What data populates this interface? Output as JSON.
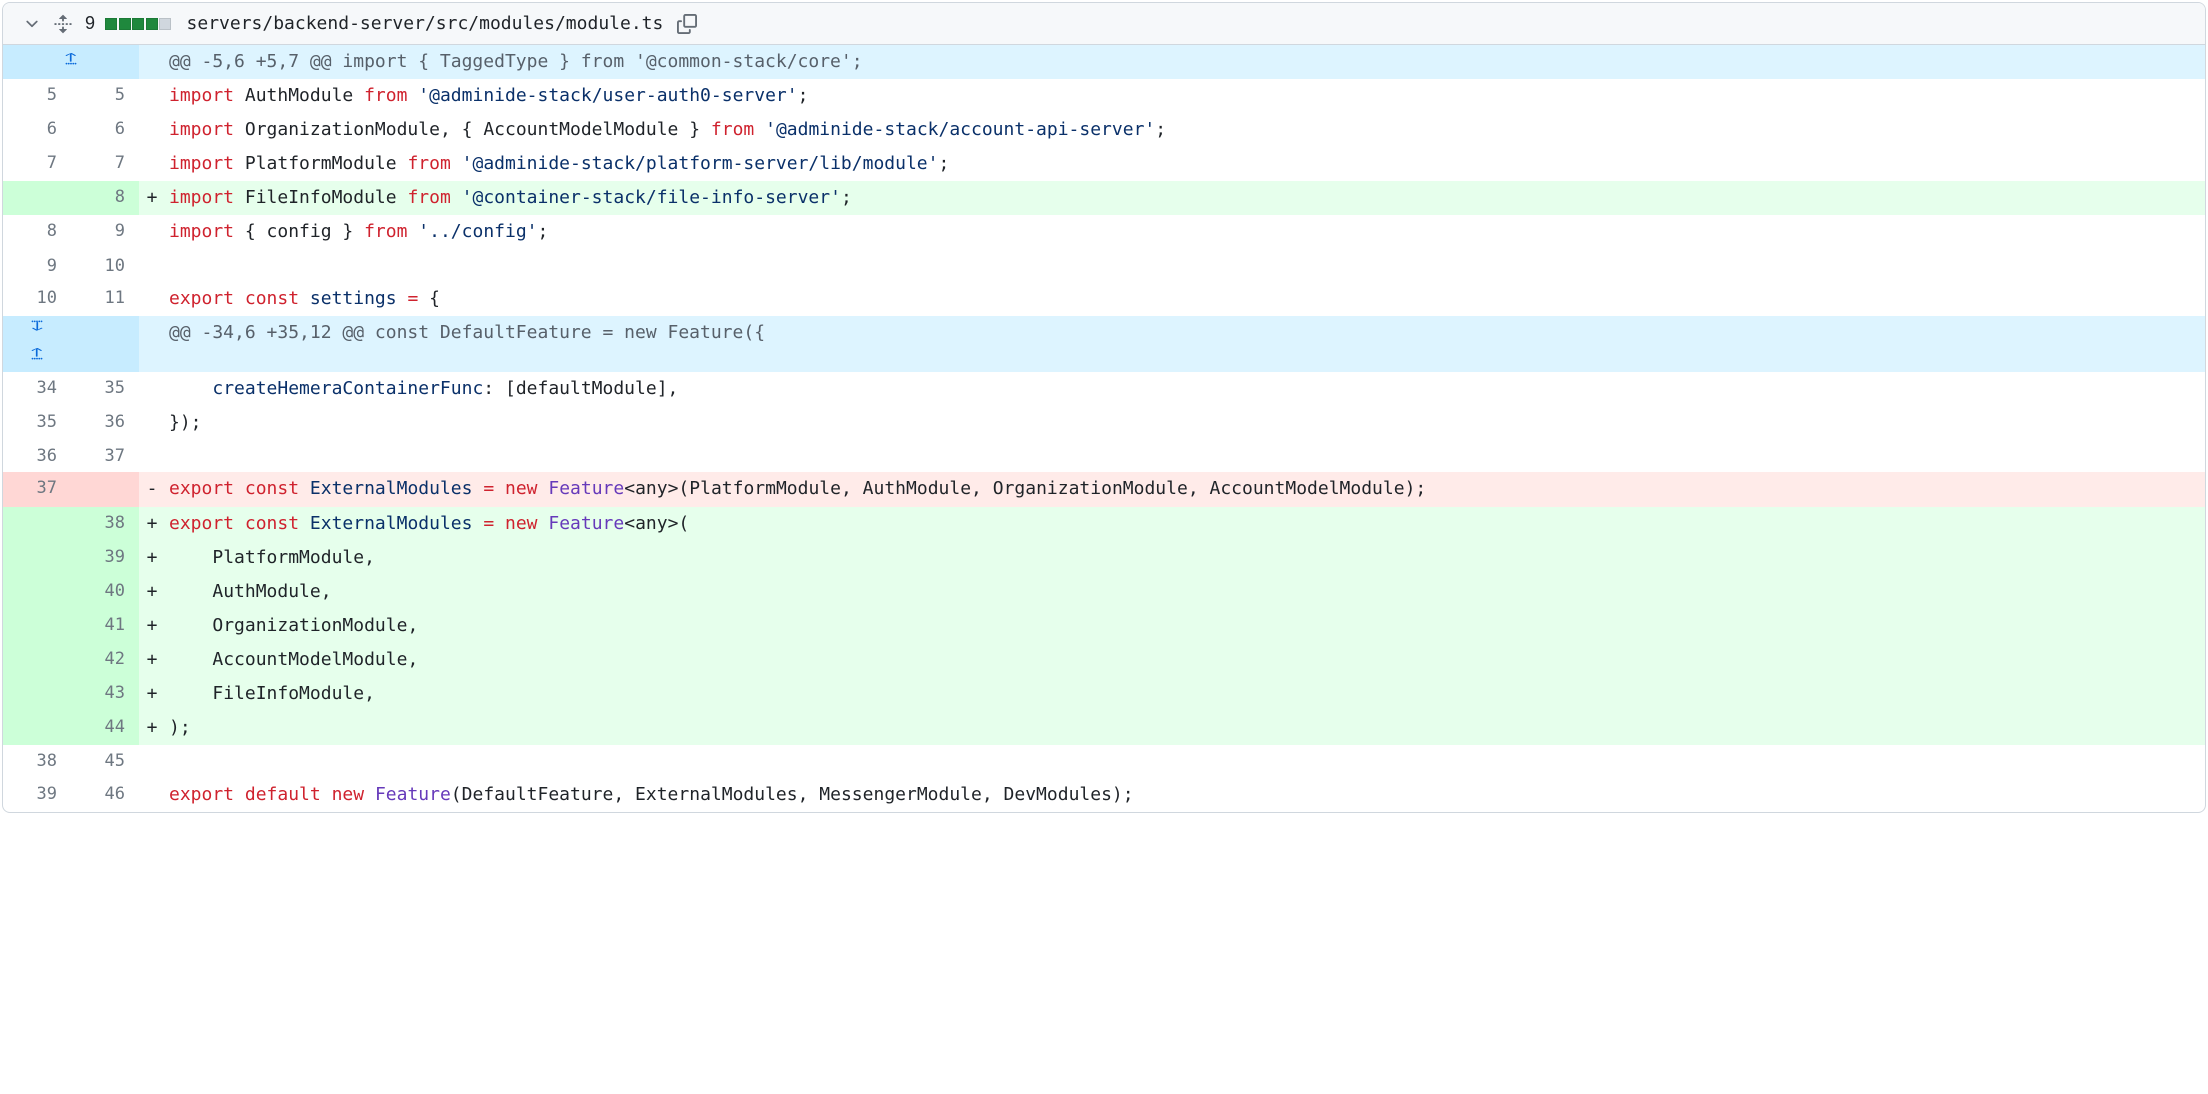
{
  "header": {
    "diff_count": "9",
    "file_path": "servers/backend-server/src/modules/module.ts"
  },
  "hunks": {
    "h1_text": "@@ -5,6 +5,7 @@ import { TaggedType } from '@common-stack/core';",
    "h2_text": "@@ -34,6 +35,12 @@ const DefaultFeature = new Feature({"
  },
  "rows": [
    {
      "old": "5",
      "new": "5",
      "marker": "",
      "type": "context",
      "code": "<span class=\"k\">import</span> <span class=\"v\">AuthModule</span> <span class=\"k\">from</span> <span class=\"s\">'@adminide-stack/user-auth0-server'</span>;"
    },
    {
      "old": "6",
      "new": "6",
      "marker": "",
      "type": "context",
      "code": "<span class=\"k\">import</span> <span class=\"v\">OrganizationModule</span>, { <span class=\"v\">AccountModelModule</span> } <span class=\"k\">from</span> <span class=\"s\">'@adminide-stack/account-api-server'</span>;"
    },
    {
      "old": "7",
      "new": "7",
      "marker": "",
      "type": "context",
      "code": "<span class=\"k\">import</span> <span class=\"v\">PlatformModule</span> <span class=\"k\">from</span> <span class=\"s\">'@adminide-stack/platform-server/lib/module'</span>;"
    },
    {
      "old": "",
      "new": "8",
      "marker": "+",
      "type": "addition",
      "code": "<span class=\"k\">import</span> <span class=\"v\">FileInfoModule</span> <span class=\"k\">from</span> <span class=\"s\">'@container-stack/file-info-server'</span>;"
    },
    {
      "old": "8",
      "new": "9",
      "marker": "",
      "type": "context",
      "code": "<span class=\"k\">import</span> { <span class=\"v\">config</span> } <span class=\"k\">from</span> <span class=\"s\">'../config'</span>;"
    },
    {
      "old": "9",
      "new": "10",
      "marker": "",
      "type": "context",
      "code": ""
    },
    {
      "old": "10",
      "new": "11",
      "marker": "",
      "type": "context",
      "code": "<span class=\"k\">export</span> <span class=\"k\">const</span> <span class=\"s\">settings</span> <span class=\"k\">=</span> {"
    },
    {
      "type": "hunk2"
    },
    {
      "old": "34",
      "new": "35",
      "marker": "",
      "type": "context",
      "code": "    <span class=\"s\">createHemeraContainerFunc</span>: [<span class=\"v\">defaultModule</span>],"
    },
    {
      "old": "35",
      "new": "36",
      "marker": "",
      "type": "context",
      "code": "});"
    },
    {
      "old": "36",
      "new": "37",
      "marker": "",
      "type": "context",
      "code": ""
    },
    {
      "old": "37",
      "new": "",
      "marker": "-",
      "type": "deletion",
      "code": "<span class=\"k\">export</span> <span class=\"k\">const</span> <span class=\"s\">ExternalModules</span> <span class=\"k\">=</span> <span class=\"k\">new</span> <span class=\"f\">Feature</span>&lt;<span class=\"v\">any</span>&gt;(<span class=\"v\">PlatformModule</span>, <span class=\"v\">AuthModule</span>, <span class=\"v\">OrganizationModule</span>, <span class=\"v\">AccountModelModule</span>);"
    },
    {
      "old": "",
      "new": "38",
      "marker": "+",
      "type": "addition",
      "code": "<span class=\"k\">export</span> <span class=\"k\">const</span> <span class=\"s\">ExternalModules</span> <span class=\"k\">=</span> <span class=\"k\">new</span> <span class=\"f\">Feature</span>&lt;<span class=\"v\">any</span>&gt;("
    },
    {
      "old": "",
      "new": "39",
      "marker": "+",
      "type": "addition",
      "code": "    <span class=\"v\">PlatformModule</span>,"
    },
    {
      "old": "",
      "new": "40",
      "marker": "+",
      "type": "addition",
      "code": "    <span class=\"v\">AuthModule</span>,"
    },
    {
      "old": "",
      "new": "41",
      "marker": "+",
      "type": "addition",
      "code": "    <span class=\"v\">OrganizationModule</span>,"
    },
    {
      "old": "",
      "new": "42",
      "marker": "+",
      "type": "addition",
      "code": "    <span class=\"v\">AccountModelModule</span>,"
    },
    {
      "old": "",
      "new": "43",
      "marker": "+",
      "type": "addition",
      "code": "    <span class=\"v\">FileInfoModule</span>,"
    },
    {
      "old": "",
      "new": "44",
      "marker": "+",
      "type": "addition",
      "code": ");"
    },
    {
      "old": "38",
      "new": "45",
      "marker": "",
      "type": "context",
      "code": ""
    },
    {
      "old": "39",
      "new": "46",
      "marker": "",
      "type": "context",
      "code": "<span class=\"k\">export</span> <span class=\"k\">default</span> <span class=\"k\">new</span> <span class=\"f\">Feature</span>(<span class=\"v\">DefaultFeature</span>, <span class=\"v\">ExternalModules</span>, <span class=\"v\">MessengerModule</span>, <span class=\"v\">DevModules</span>);"
    }
  ]
}
